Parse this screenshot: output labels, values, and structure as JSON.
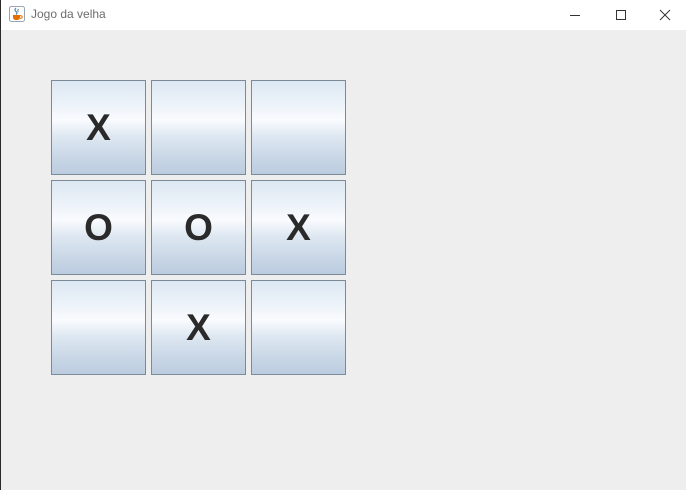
{
  "window": {
    "title": "Jogo da velha",
    "app_icon": "java-cup-icon",
    "controls": {
      "minimize_icon": "minimize-icon",
      "maximize_icon": "maximize-icon",
      "close_icon": "close-icon"
    }
  },
  "board": {
    "cells": [
      "X",
      "",
      "",
      "O",
      "O",
      "X",
      "",
      "X",
      ""
    ]
  },
  "colors": {
    "mark": "#2a2a2a",
    "cell_border": "#7a8a99",
    "background": "#eeeeee"
  }
}
